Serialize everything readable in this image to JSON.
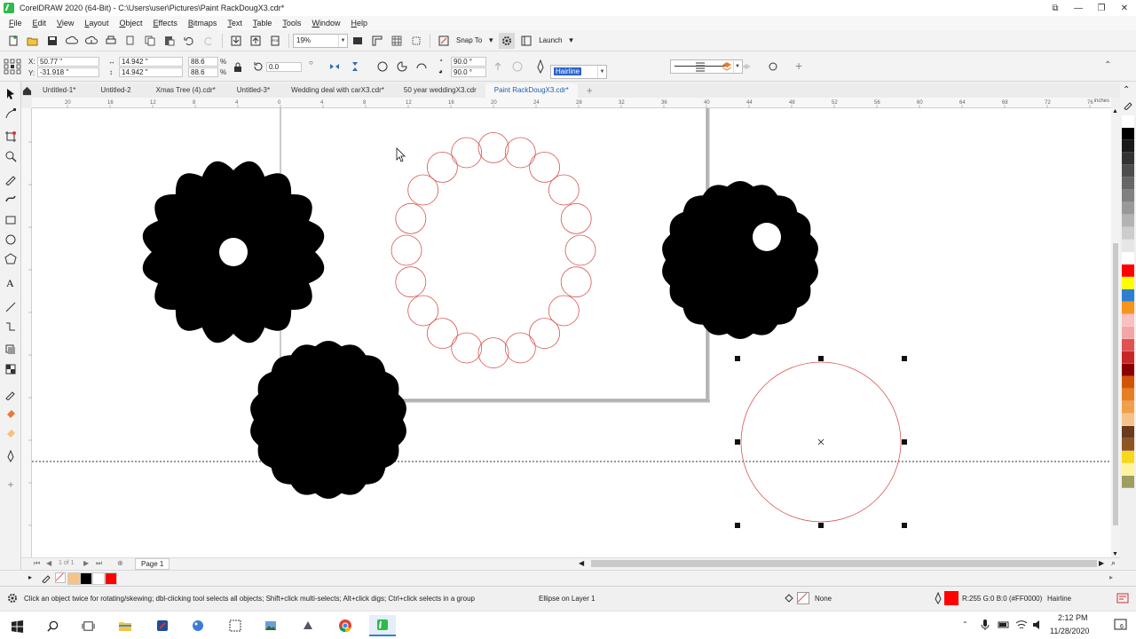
{
  "window": {
    "title": "CorelDRAW 2020 (64-Bit) - C:\\Users\\user\\Pictures\\Paint RackDougX3.cdr*"
  },
  "menu": [
    "File",
    "Edit",
    "View",
    "Layout",
    "Object",
    "Effects",
    "Bitmaps",
    "Text",
    "Table",
    "Tools",
    "Window",
    "Help"
  ],
  "toolbar": {
    "zoom": "19%",
    "snap_to": "Snap To",
    "launch": "Launch"
  },
  "propbar": {
    "x_label": "X:",
    "x": "50.77 \"",
    "y_label": "Y:",
    "y": "-31.918 \"",
    "w": "14.942 \"",
    "h": "14.942 \"",
    "scale_w": "88.6",
    "scale_h": "88.6",
    "pct": "%",
    "rotation": "0.0",
    "angle_start": "90.0 °",
    "angle_end": "90.0 °",
    "outline_width": "Hairline"
  },
  "tabs": [
    {
      "label": "Untitled-1*",
      "active": false
    },
    {
      "label": "Untitled-2",
      "active": false
    },
    {
      "label": "Xmas Tree (4).cdr*",
      "active": false
    },
    {
      "label": "Untitled-3*",
      "active": false
    },
    {
      "label": "Wedding deal with carX3.cdr*",
      "active": false
    },
    {
      "label": "50 year weddingX3.cdr",
      "active": false
    },
    {
      "label": "Paint RackDougX3.cdr*",
      "active": true
    }
  ],
  "ruler": {
    "marks": [
      "20",
      "16",
      "12",
      "8",
      "4",
      "0",
      "4",
      "8",
      "12",
      "16",
      "20",
      "24",
      "28",
      "32",
      "36",
      "40",
      "44",
      "48",
      "52",
      "56",
      "60",
      "64",
      "68",
      "72",
      "76"
    ],
    "units": "inches"
  },
  "page_nav": {
    "counter": "1 of 1",
    "page_tab": "Page 1"
  },
  "status": {
    "hint": "Click an object twice for rotating/skewing; dbl-clicking tool selects all objects; Shift+click multi-selects; Alt+click digs; Ctrl+click selects in a group",
    "selection": "Ellipse on Layer 1",
    "fill": "None",
    "outline": "R:255 G:0 B:0 (#FF0000)",
    "outline_width": "Hairline",
    "outline_color": "#FF0000"
  },
  "palette": [
    "#ffffff",
    "#000000",
    "#1a1a1a",
    "#333333",
    "#4d4d4d",
    "#666666",
    "#808080",
    "#999999",
    "#b3b3b3",
    "#cccccc",
    "#e6e6e6",
    "#ffffff",
    "#ff0000",
    "#ffff00",
    "#2b7fd1",
    "#f7941d",
    "#f9c0c0",
    "#f4a6a6",
    "#e05252",
    "#c62828",
    "#8b0000",
    "#d35400",
    "#e67e22",
    "#f0a04b",
    "#f5c38a",
    "#6b3a1e",
    "#8d5524",
    "#f9d71c",
    "#fff3a0",
    "#9e9e5e"
  ],
  "colorrow": [
    "#f5c38a",
    "#000000",
    "#ffffff",
    "#ff0000"
  ],
  "taskbar": {
    "time": "2:12 PM",
    "date": "11/28/2020",
    "notif_count": "6"
  }
}
